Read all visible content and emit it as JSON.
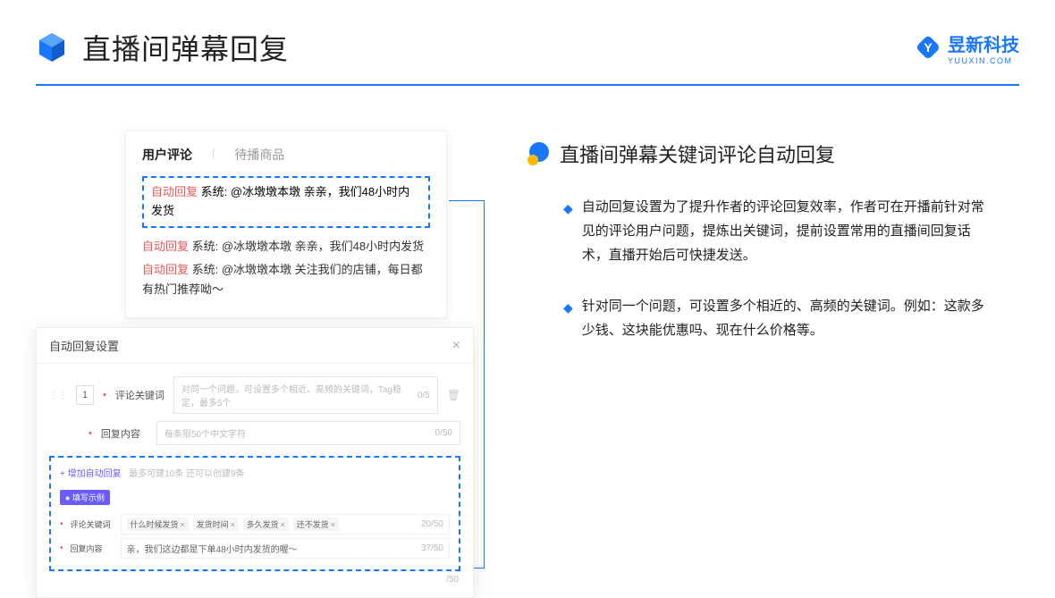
{
  "header": {
    "title": "直播间弹幕回复",
    "brand_name": "昱新科技",
    "brand_sub": "YUUXIN.COM"
  },
  "comments": {
    "tab_active": "用户评论",
    "tab_inactive": "待播商品",
    "highlighted": {
      "tag": "自动回复",
      "text": "系统: @冰墩墩本墩 亲亲，我们48小时内发货"
    },
    "rows": [
      {
        "tag": "自动回复",
        "text": "系统: @冰墩墩本墩 亲亲，我们48小时内发货"
      },
      {
        "tag": "自动回复",
        "text": "系统: @冰墩墩本墩 关注我们的店铺，每日都有热门推荐呦～"
      }
    ]
  },
  "settings": {
    "title": "自动回复设置",
    "index": "1",
    "keyword_label": "评论关键词",
    "keyword_placeholder": "对同一个问题，可设置多个相近、高频的关键词，Tag稳定，最多5个",
    "keyword_count": "0/5",
    "content_label": "回复内容",
    "content_placeholder": "每条限50个中文字符",
    "content_count": "0/50",
    "add_link": "+ 增加自动回复",
    "add_hint": "最多可建10条 还可以创建9条",
    "example_tag": "● 填写示例",
    "ex_keyword_label": "评论关键词",
    "ex_chips": [
      "什么时候发货",
      "发货时间",
      "多久发货",
      "还不发货"
    ],
    "ex_keyword_count": "20/50",
    "ex_content_label": "回复内容",
    "ex_content_value": "亲，我们这边都是下单48小时内发货的喔～",
    "ex_content_count": "37/50",
    "outer_count": "/50"
  },
  "right": {
    "section_title": "直播间弹幕关键词评论自动回复",
    "bullets": [
      "自动回复设置为了提升作者的评论回复效率，作者可在开播前针对常见的评论用户问题，提炼出关键词，提前设置常用的直播间回复话术，直播开始后可快捷发送。",
      "针对同一个问题，可设置多个相近的、高频的关键词。例如：这款多少钱、这块能优惠吗、现在什么价格等。"
    ]
  }
}
